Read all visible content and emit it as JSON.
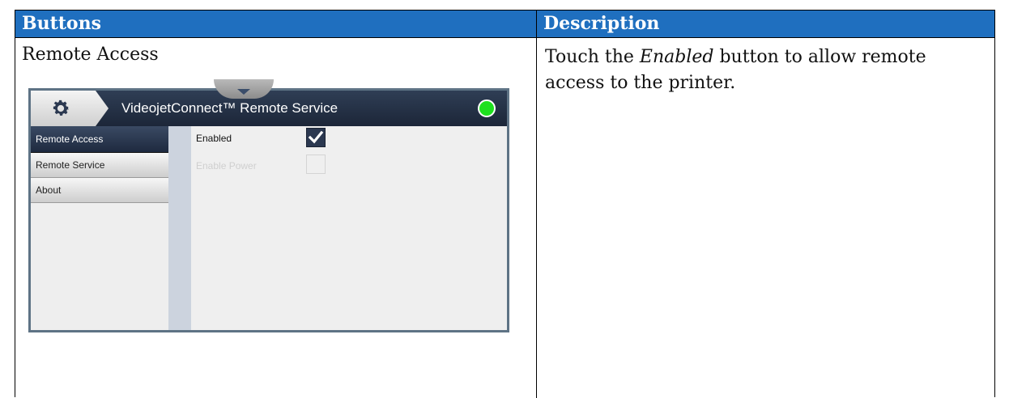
{
  "table": {
    "header_buttons": "Buttons",
    "header_description": "Description",
    "row": {
      "button_name": "Remote Access",
      "description_before": "Touch the ",
      "description_em": "Enabled",
      "description_after": " button to allow remote access to the printer."
    }
  },
  "device": {
    "title": "VideojetConnect™ Remote Service",
    "status_color": "#1ee01e",
    "accent_color": "#1f6fbf",
    "sidebar": {
      "items": [
        {
          "label": "Remote Access",
          "active": true
        },
        {
          "label": "Remote Service",
          "active": false
        },
        {
          "label": "About",
          "active": false
        }
      ]
    },
    "options": {
      "enabled_label": "Enabled",
      "enabled_checked": true,
      "enable_power_label": "Enable Power",
      "enable_power_checked": false
    }
  }
}
